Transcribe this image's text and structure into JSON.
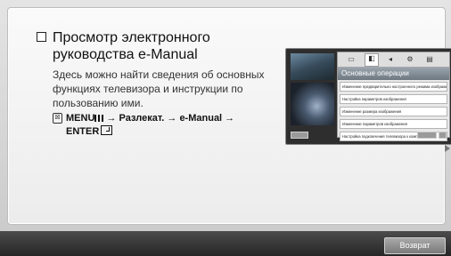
{
  "page": {
    "title": "Просмотр электронного руководства e-Manual",
    "description": "Здесь можно найти сведения об основных функциях телевизора и инструкции по пользованию ими.",
    "path_icon_glyph": "☒",
    "path_part1": "MENU",
    "path_part2": " → Разлекат. → e-Manual → ENTER"
  },
  "preview": {
    "header": "Основные операции",
    "items": [
      "Изменение предварительно настроенного режима изображения",
      "Настройка параметров изображения",
      "Изменение размера изображения",
      "Изменение параметров изображения",
      "Настройка подключения телевизора к компьютеру"
    ]
  },
  "footer": {
    "back_label": "Возврат"
  }
}
